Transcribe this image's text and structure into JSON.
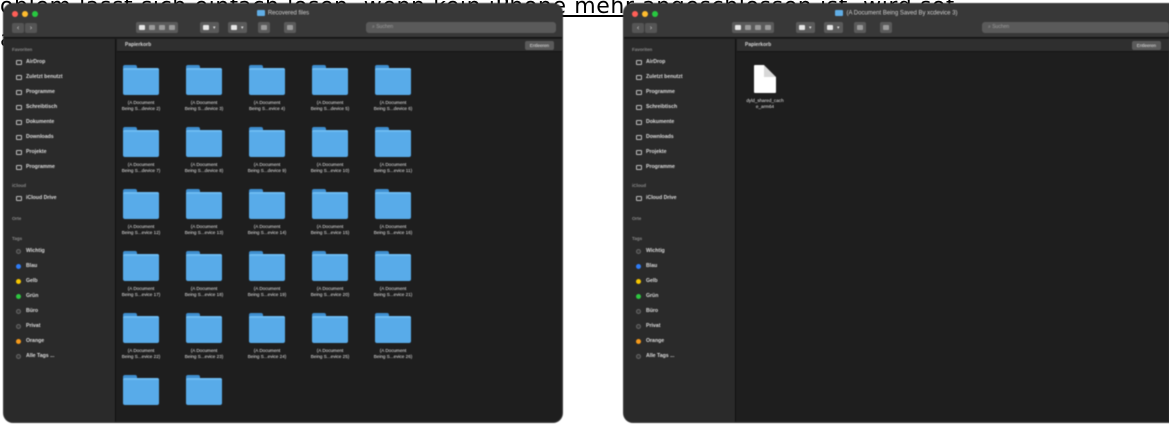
{
  "caption": {
    "line1_before": "oblem lässt sich einfach lösen, wenn kein ",
    "line1_underlined": "iPhone mehr angeschlossen ist, wird sof",
    "line2": "a"
  },
  "sidebar": {
    "favorites_label": "Favoriten",
    "favorites": [
      {
        "label": "AirDrop",
        "icon": "airdrop-icon"
      },
      {
        "label": "Zuletzt benutzt",
        "icon": "clock-icon"
      },
      {
        "label": "Programme",
        "icon": "apps-icon"
      },
      {
        "label": "Schreibtisch",
        "icon": "desktop-icon"
      },
      {
        "label": "Dokumente",
        "icon": "document-icon"
      },
      {
        "label": "Downloads",
        "icon": "download-icon"
      },
      {
        "label": "Projekte",
        "icon": "folder-icon"
      },
      {
        "label": "Programme",
        "icon": "folder-icon"
      }
    ],
    "icloud_label": "iCloud",
    "icloud": [
      {
        "label": "iCloud Drive",
        "icon": "cloud-icon"
      }
    ],
    "orte_label": "Orte",
    "tags_label": "Tags",
    "tags": [
      {
        "label": "Wichtig",
        "color": "#3a3a3a"
      },
      {
        "label": "Blau",
        "color": "#2f7cf6"
      },
      {
        "label": "Gelb",
        "color": "#f7c600"
      },
      {
        "label": "Grün",
        "color": "#2ec640"
      },
      {
        "label": "Büro",
        "color": "#3a3a3a"
      },
      {
        "label": "Privat",
        "color": "#3a3a3a"
      },
      {
        "label": "Orange",
        "color": "#f59a1b"
      },
      {
        "label": "Alle Tags ...",
        "color": "#3a3a3a"
      }
    ]
  },
  "window1": {
    "title": "Recovered files",
    "path_label": "Papierkorb",
    "empty_button": "Entleeren",
    "search_placeholder": "Suchen",
    "items": [
      [
        "(A Document",
        "Being S...device 2)"
      ],
      [
        "(A Document",
        "Being S...device 3)"
      ],
      [
        "(A Document",
        "Being S...evice 4)"
      ],
      [
        "(A Document",
        "Being S...device 5)"
      ],
      [
        "(A Document",
        "Being S...device 6)"
      ],
      [
        "(A Document",
        "Being S...device 7)"
      ],
      [
        "(A Document",
        "Being S...device 8)"
      ],
      [
        "(A Document",
        "Being S...device 9)"
      ],
      [
        "(A Document",
        "Being S...evice 10)"
      ],
      [
        "(A Document",
        "Being S...evice 11)"
      ],
      [
        "(A Document",
        "Being S...evice 12)"
      ],
      [
        "(A Document",
        "Being S...evice 13)"
      ],
      [
        "(A Document",
        "Being S...evice 14)"
      ],
      [
        "(A Document",
        "Being S...evice 15)"
      ],
      [
        "(A Document",
        "Being S...evice 16)"
      ],
      [
        "(A Document",
        "Being S...evice 17)"
      ],
      [
        "(A Document",
        "Being S...evice 18)"
      ],
      [
        "(A Document",
        "Being S...evice 19)"
      ],
      [
        "(A Document",
        "Being S...evice 20)"
      ],
      [
        "(A Document",
        "Being S...evice 21)"
      ],
      [
        "(A Document",
        "Being S...evice 22)"
      ],
      [
        "(A Document",
        "Being S...evice 23)"
      ],
      [
        "(A Document",
        "Being S...evice 24)"
      ],
      [
        "(A Document",
        "Being S...evice 25)"
      ],
      [
        "(A Document",
        "Being S...evice 26)"
      ],
      [
        "",
        ""
      ],
      [
        "",
        ""
      ]
    ]
  },
  "window2": {
    "title": "(A Document Being Saved By xcdevice 3)",
    "path_label": "Papierkorb",
    "empty_button": "Entleeren",
    "search_placeholder": "Suchen",
    "items": [
      [
        "dyld_shared_cach",
        "e_arm64"
      ]
    ]
  },
  "colors": {
    "folder": "#58abe9",
    "window_bg": "#1e1e1e",
    "sidebar_bg": "#2a2a2a"
  }
}
